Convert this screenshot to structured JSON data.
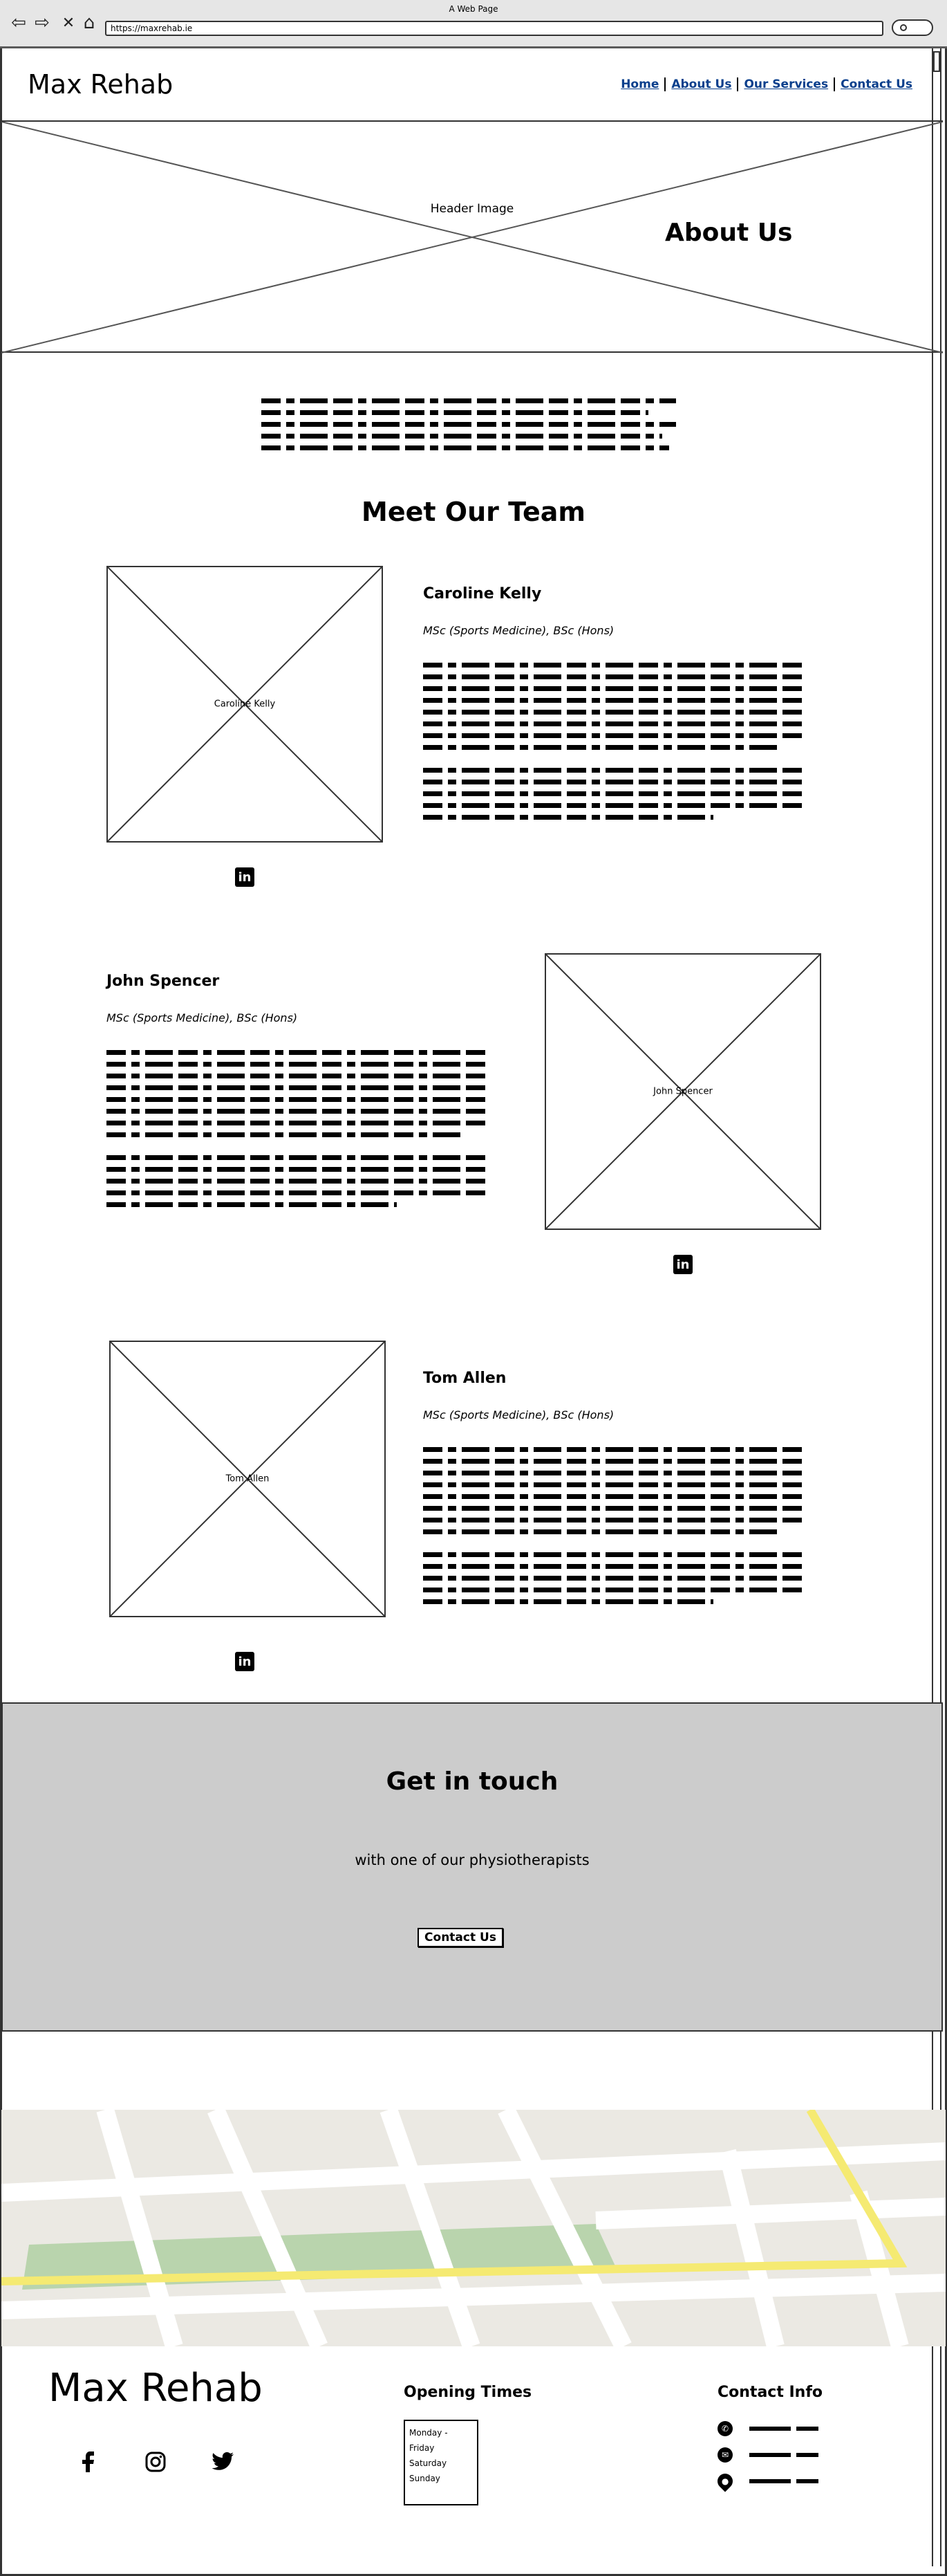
{
  "browser": {
    "title": "A Web Page",
    "url": "https://maxrehab.ie"
  },
  "header": {
    "logo": "Max Rehab",
    "nav": [
      "Home",
      "About Us",
      "Our Services",
      "Contact Us"
    ]
  },
  "hero": {
    "image_label": "Header Image",
    "title": "About Us"
  },
  "team": {
    "heading": "Meet Our Team",
    "members": [
      {
        "name": "Caroline Kelly",
        "image_label": "Caroline Kelly",
        "qualifications": "MSc (Sports Medicine), BSc (Hons)",
        "social_icon": "linkedin-icon"
      },
      {
        "name": "John Spencer",
        "image_label": "John Spencer",
        "qualifications": "MSc (Sports Medicine), BSc (Hons)",
        "social_icon": "linkedin-icon"
      },
      {
        "name": "Tom Allen",
        "image_label": "Tom Allen",
        "qualifications": "MSc (Sports Medicine), BSc (Hons)",
        "social_icon": "linkedin-icon"
      }
    ]
  },
  "cta": {
    "title": "Get in touch",
    "subtitle": "with one of our physiotherapists",
    "button": "Contact Us"
  },
  "footer": {
    "logo": "Max Rehab",
    "social_icons": [
      "facebook-icon",
      "instagram-icon",
      "twitter-icon"
    ],
    "opening_times": {
      "title": "Opening Times",
      "days": [
        "Monday - Friday",
        "Saturday",
        "Sunday"
      ]
    },
    "contact": {
      "title": "Contact Info",
      "icons": [
        "phone-icon",
        "email-icon",
        "location-pin-icon"
      ]
    }
  },
  "colors": {
    "link": "#0a3f8c",
    "cta_background": "#cccccc",
    "map_road_major": "#f5ea72",
    "map_park": "#b9d4ad"
  }
}
